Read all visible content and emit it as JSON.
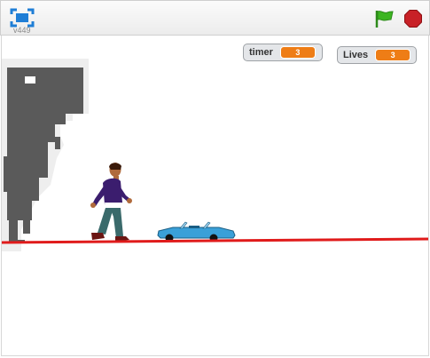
{
  "player": {
    "version": "v449",
    "icons": {
      "fullscreen": "fullscreen-icon",
      "green_flag": "green-flag-icon",
      "stop": "stop-sign-icon"
    },
    "colors": {
      "green_flag": "#3cb521",
      "stop": "#c82127",
      "fullscreen": "#1f7ed6"
    }
  },
  "stage": {
    "monitors": [
      {
        "label": "timer",
        "value": "3"
      },
      {
        "label": "Lives",
        "value": "3"
      }
    ],
    "sprites": [
      "dinosaur",
      "walking-man",
      "blue-convertible-car"
    ],
    "ground_color": "#e01b1b",
    "monitor_value_color": "#ee7d16"
  }
}
